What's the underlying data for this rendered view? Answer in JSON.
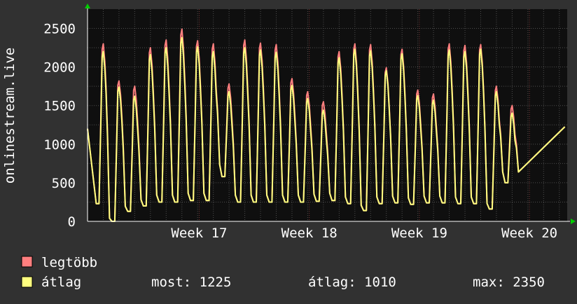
{
  "chart_data": {
    "type": "line",
    "ylabel": "onlinestream.live",
    "ylim": [
      0,
      2500
    ],
    "y_ticks": [
      0,
      500,
      1000,
      1500,
      2000,
      2500
    ],
    "x_ticks": [
      {
        "label": "Week 17",
        "at": 7.1
      },
      {
        "label": "Week 18",
        "at": 14.1
      },
      {
        "label": "Week 19",
        "at": 21.1
      },
      {
        "label": "Week 20",
        "at": 28.1
      }
    ],
    "x_range": [
      0,
      30.5
    ],
    "grid": true,
    "legend": "bottom-left",
    "series": [
      {
        "name": "legtöbb",
        "color": "#ff7f7f",
        "peaks": [
          2300,
          1820,
          1750,
          2250,
          2350,
          2490,
          2340,
          2300,
          1780,
          2350,
          2310,
          2290,
          1850,
          1680,
          1550,
          2200,
          2300,
          2290,
          1990,
          2230,
          1700,
          1650,
          2300,
          2280,
          2290,
          1750,
          1500
        ],
        "troughs": [
          230,
          0,
          130,
          200,
          250,
          250,
          270,
          270,
          580,
          250,
          250,
          250,
          250,
          250,
          260,
          270,
          230,
          140,
          230,
          240,
          220,
          240,
          240,
          230,
          230,
          160,
          500
        ]
      },
      {
        "name": "átlag",
        "color": "#ffff7f",
        "peaks": [
          2200,
          1740,
          1620,
          2160,
          2250,
          2380,
          2260,
          2200,
          1680,
          2250,
          2220,
          2190,
          1760,
          1590,
          1440,
          2120,
          2230,
          2210,
          1950,
          2170,
          1630,
          1570,
          2220,
          2200,
          2230,
          1680,
          1400
        ],
        "troughs": [
          230,
          0,
          130,
          200,
          250,
          250,
          270,
          270,
          580,
          250,
          250,
          250,
          250,
          250,
          260,
          270,
          230,
          140,
          230,
          240,
          220,
          240,
          240,
          230,
          230,
          160,
          500
        ]
      }
    ]
  },
  "legend": {
    "items": [
      {
        "label": "legtöbb",
        "color": "#ff7f7f"
      },
      {
        "label": "átlag",
        "color": "#ffff7f"
      }
    ],
    "stats": {
      "most": "most: 1225",
      "atlag": "átlag: 1010",
      "max": "max: 2350"
    }
  },
  "colors": {
    "background": "#313131",
    "plot_background": "#0f0f0f",
    "grid": "#4d4d4d",
    "week_grid": "#7a3535",
    "text": "#ffffff",
    "arrow": "#00cc00"
  }
}
